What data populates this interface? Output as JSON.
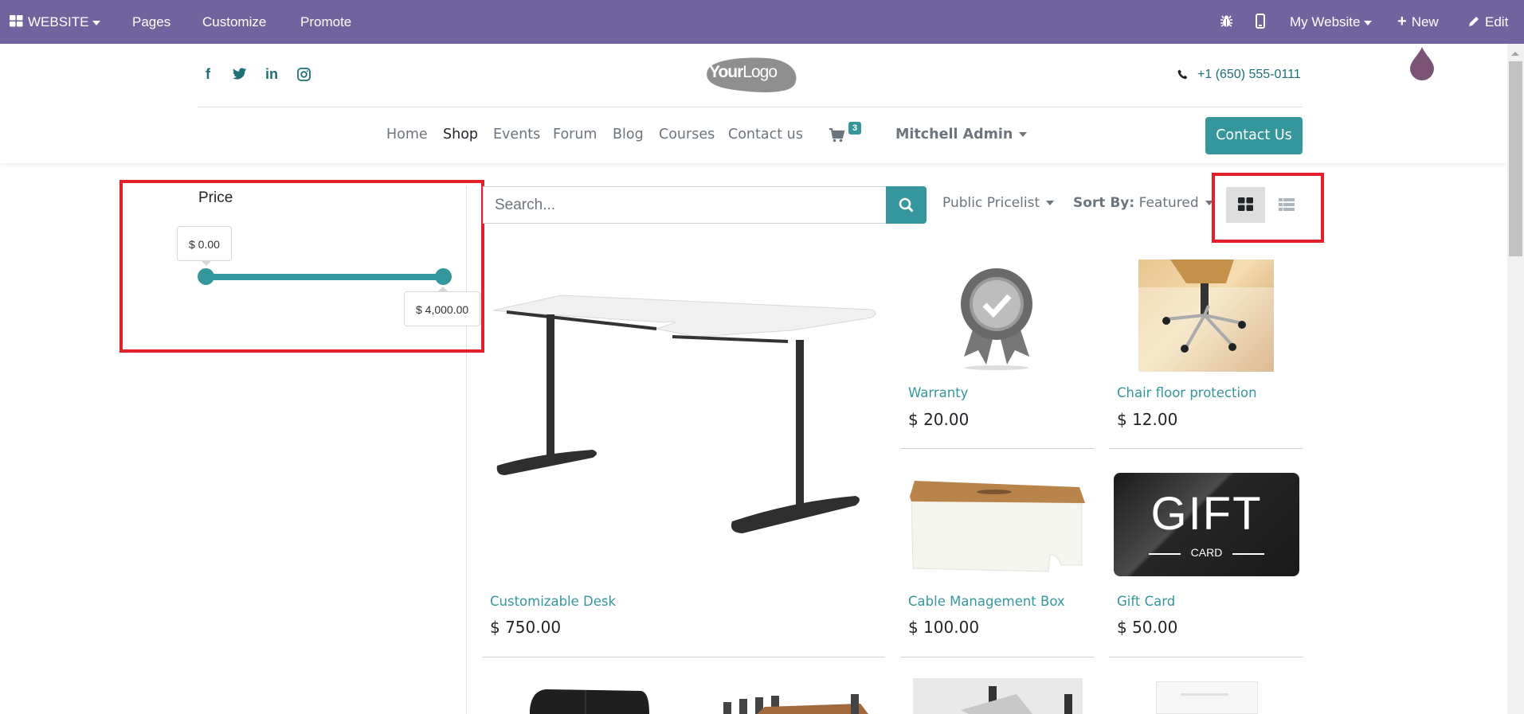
{
  "topbar": {
    "app_label": "WEBSITE",
    "menu": [
      "Pages",
      "Customize",
      "Promote"
    ],
    "website_selector": "My Website",
    "new_label": "New",
    "edit_label": "Edit"
  },
  "header": {
    "logo_text_bold": "Your",
    "logo_text_light": "Logo",
    "phone": "+1 (650) 555-0111",
    "nav": [
      "Home",
      "Shop",
      "Events",
      "Forum",
      "Blog",
      "Courses",
      "Contact us"
    ],
    "active_nav": "Shop",
    "cart_count": "3",
    "user_name": "Mitchell Admin",
    "contact_button": "Contact Us"
  },
  "filters": {
    "price_title": "Price",
    "price_min_label": "$ 0.00",
    "price_max_label": "$ 4,000.00",
    "range_min": 0,
    "range_max": 4000,
    "selected_min": 0,
    "selected_max": 4000
  },
  "toolbar": {
    "search_placeholder": "Search...",
    "pricelist": "Public Pricelist",
    "sort_label": "Sort By:",
    "sort_value": "Featured",
    "view_mode": "grid"
  },
  "products": [
    {
      "name": "Customizable Desk",
      "price": "$ 750.00"
    },
    {
      "name": "Warranty",
      "price": "$ 20.00"
    },
    {
      "name": "Chair floor protection",
      "price": "$ 12.00"
    },
    {
      "name": "Cable Management Box",
      "price": "$ 100.00"
    },
    {
      "name": "Gift Card",
      "price": "$ 50.00"
    }
  ],
  "gift_card_image": {
    "big": "GIFT",
    "small": "CARD"
  },
  "colors": {
    "admin_bar": "#71639e",
    "accent": "#35979c",
    "highlight": "#e3202a"
  }
}
